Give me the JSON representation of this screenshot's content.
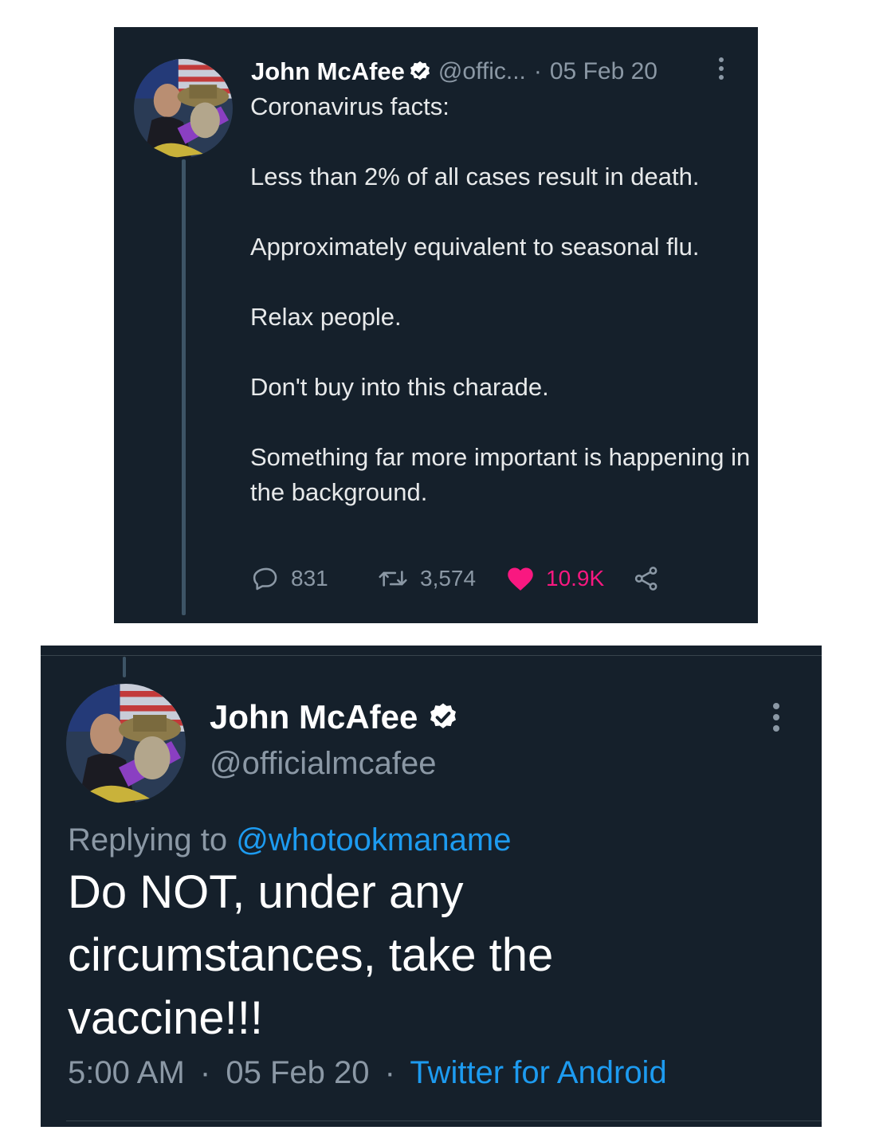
{
  "tweet": {
    "author_name": "John McAfee",
    "author_handle_truncated": "@offic...",
    "separator": "·",
    "date": "05 Feb 20",
    "body": [
      "Coronavirus facts:",
      "Less than 2% of all cases result in death.",
      "Approximately equivalent to seasonal flu.",
      "Relax people.",
      "Don't buy into this charade.",
      "Something far more important is happening in the background."
    ],
    "stats": {
      "replies": "831",
      "retweets": "3,574",
      "likes": "10.9K"
    },
    "icons": [
      "verified-badge-icon",
      "more-options-icon",
      "reply-icon",
      "retweet-icon",
      "like-heart-icon",
      "share-icon"
    ]
  },
  "reply": {
    "author_name": "John McAfee",
    "author_handle": "@officialmcafee",
    "replying_to_label": "Replying to ",
    "replying_to_handle": "@whotookmaname",
    "text": "Do NOT, under any circumstances, take the vaccine!!!",
    "time": "5:00 AM",
    "separator": "·",
    "date": "05 Feb 20",
    "source": "Twitter for Android"
  },
  "colors": {
    "background": "#15202b",
    "text_primary": "#e7e9ea",
    "text_muted": "#8b98a5",
    "link": "#1d9bf0",
    "like": "#f91880",
    "thread_line": "#3d5466"
  }
}
